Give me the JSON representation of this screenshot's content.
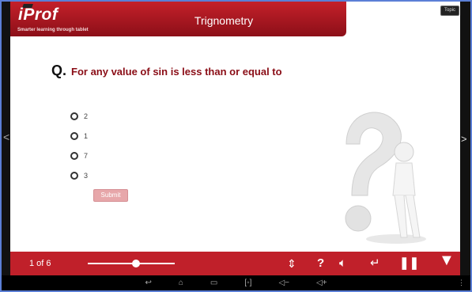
{
  "app": {
    "brand": "iProf",
    "tagline": "Smarter learning through tablet",
    "subject": "Trignometry",
    "topic_button": "Topic"
  },
  "question": {
    "prefix": "Q.",
    "text": "For any value of sin is less than or equal to"
  },
  "options": [
    "2",
    "1",
    "7",
    "3"
  ],
  "submit_label": "Submit",
  "player": {
    "page_label": "1 of 6",
    "progress": 0.55
  },
  "icons": [
    "left-chevron-icon",
    "right-chevron-icon",
    "expand-collapse-icon",
    "help-icon",
    "volume-icon",
    "exit-icon",
    "pause-icon",
    "chevron-down-icon",
    "back-icon",
    "home-icon",
    "recent-apps-icon",
    "screenshot-icon",
    "volume-down-icon",
    "volume-up-icon",
    "menu-icon"
  ],
  "colors": {
    "accent": "#c0202a",
    "question": "#8a0d16",
    "submit": "#e7a7aa"
  }
}
